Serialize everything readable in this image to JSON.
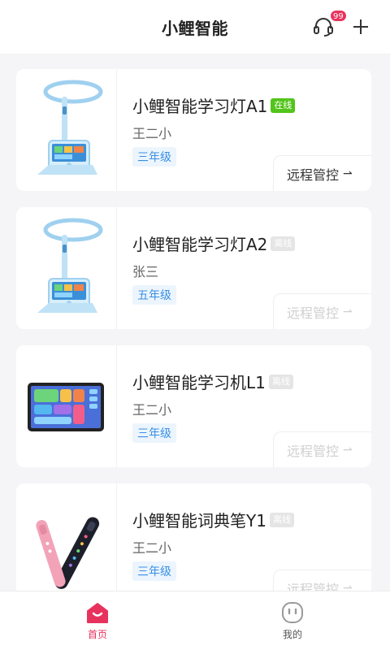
{
  "header": {
    "title": "小鲤智能",
    "support_badge": "99"
  },
  "devices": [
    {
      "name": "小鲤智能学习灯A1",
      "status": "在线",
      "owner": "王二小",
      "grade": "三年级",
      "action": "远程管控",
      "image": "desk-lamp",
      "online": true
    },
    {
      "name": "小鲤智能学习灯A2",
      "status": "离线",
      "owner": "张三",
      "grade": "五年级",
      "action": "远程管控",
      "image": "desk-lamp",
      "online": false
    },
    {
      "name": "小鲤智能学习机L1",
      "status": "离线",
      "owner": "王二小",
      "grade": "三年级",
      "action": "远程管控",
      "image": "tablet",
      "online": false
    },
    {
      "name": "小鲤智能词典笔Y1",
      "status": "离线",
      "owner": "王二小",
      "grade": "三年级",
      "action": "远程管控",
      "image": "dictionary-pen",
      "online": false
    }
  ],
  "tabs": [
    {
      "label": "首页",
      "icon": "home-icon",
      "active": true
    },
    {
      "label": "我的",
      "icon": "profile-face-icon",
      "active": false
    }
  ],
  "colors": {
    "accent": "#e8325e",
    "online": "#52c41a",
    "grade_text": "#3a8fe6",
    "grade_bg": "#ecf5fd"
  }
}
